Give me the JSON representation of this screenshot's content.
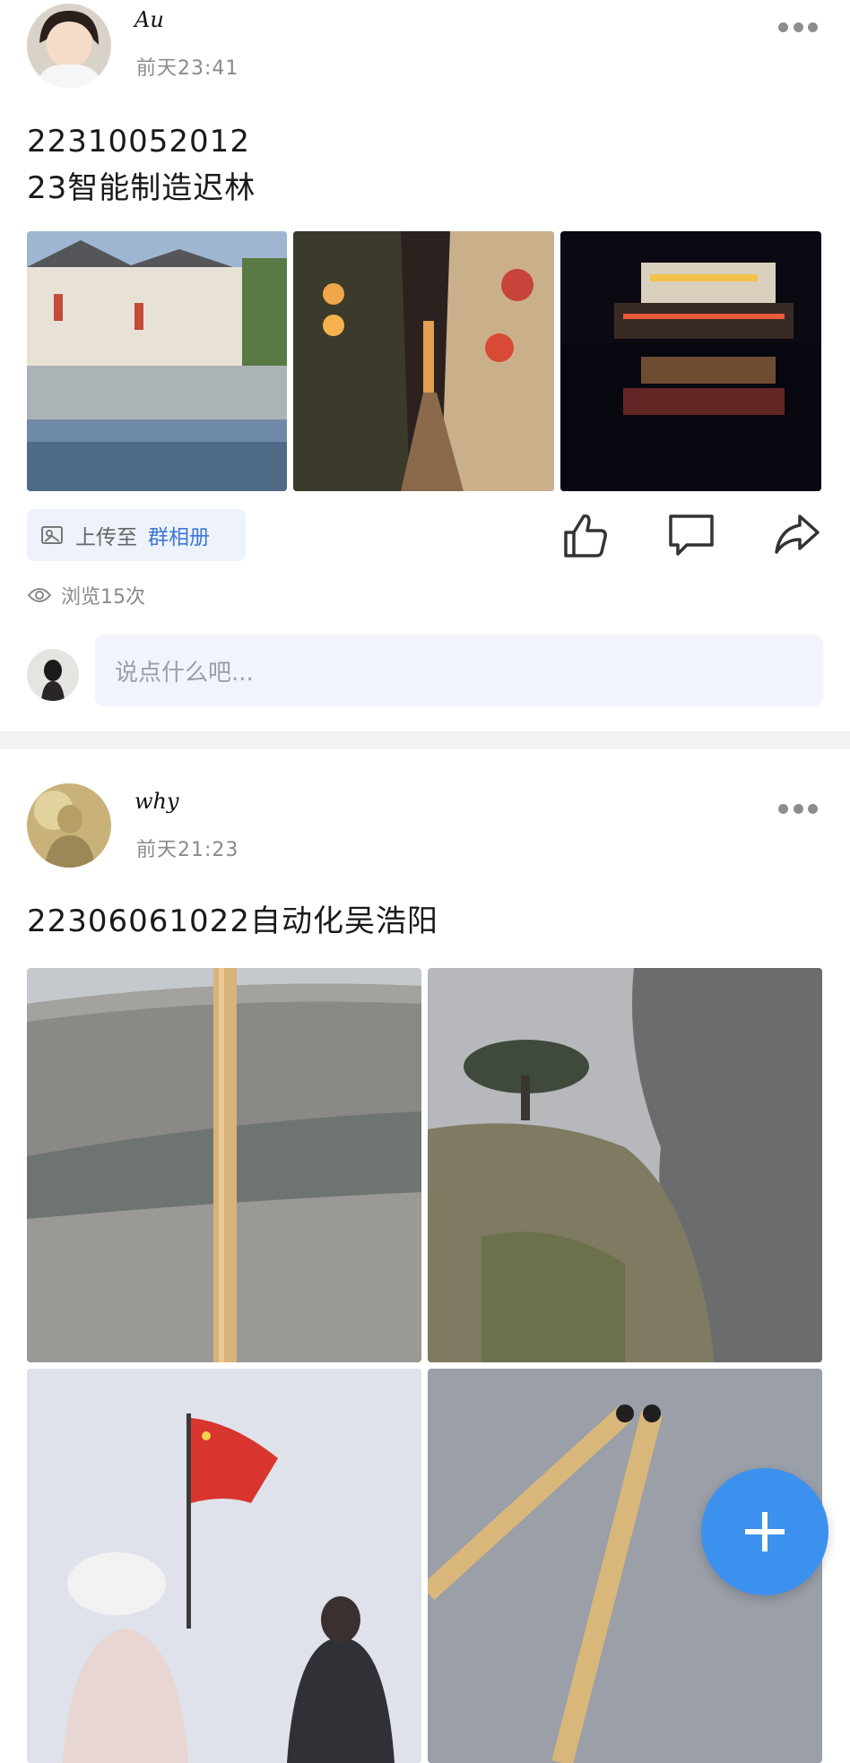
{
  "posts": [
    {
      "user": "Au",
      "time": "前天23:41",
      "content": "22310052012\n23智能制造迟林",
      "upload_prefix": "上传至",
      "upload_target": "群相册",
      "views": "浏览15次",
      "comment_placeholder": "说点什么吧..."
    },
    {
      "user": "why",
      "time": "前天21:23",
      "content": "22306061022自动化吴浩阳"
    }
  ],
  "colors": {
    "accent": "#3d91ee",
    "link": "#3f78d6",
    "muted": "#8a8a8a"
  },
  "icons": [
    "more-icon",
    "like-icon",
    "comment-icon",
    "share-icon",
    "eye-icon",
    "album-icon",
    "plus-icon"
  ]
}
